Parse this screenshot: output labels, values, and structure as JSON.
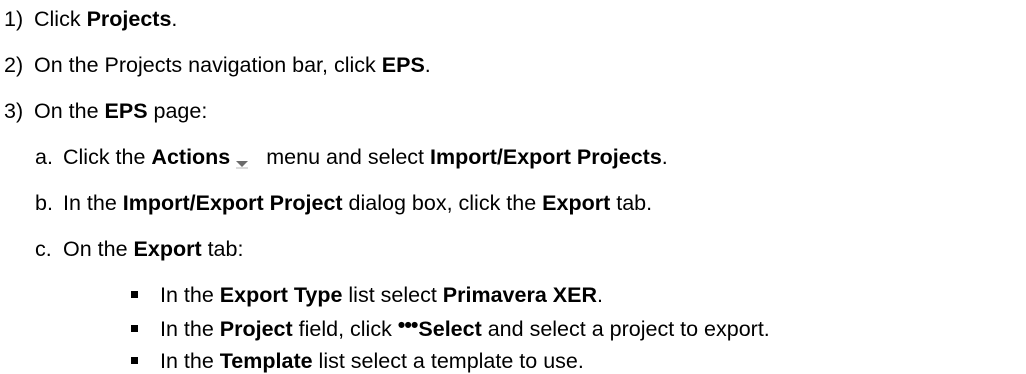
{
  "steps": [
    {
      "num": "1)",
      "t1": "Click ",
      "b1": "Projects",
      "t2": "."
    },
    {
      "num": "2)",
      "t1": "On the Projects navigation bar, click ",
      "b1": "EPS",
      "t2": "."
    },
    {
      "num": "3)",
      "t1": "On the ",
      "b1": "EPS",
      "t2": " page:"
    }
  ],
  "substeps": [
    {
      "letter": "a.",
      "t1": "Click the ",
      "b1": "Actions",
      "icon": "dropdown-arrow-icon",
      "t2": "menu and select ",
      "b2": "Import/Export Projects",
      "t3": "."
    },
    {
      "letter": "b.",
      "t1": "In the ",
      "b1": "Import/Export Project",
      "t2": " dialog box, click the ",
      "b2": "Export",
      "t3": " tab."
    },
    {
      "letter": "c.",
      "t1": "On the ",
      "b1": "Export",
      "t2": " tab:"
    }
  ],
  "bullets": [
    {
      "t1": "In the ",
      "b1": "Export Type",
      "t2": " list select ",
      "b2": "Primavera XER",
      "t3": "."
    },
    {
      "t1": "In the ",
      "b1": "Project",
      "t2": " field, click ",
      "ellipsis": "•••",
      "b2": "Select",
      "t3": " and select a project to export."
    },
    {
      "t1": "In the ",
      "b1": "Template",
      "t2": " list select a template to use."
    }
  ],
  "colors": {
    "icon_arrow": "#6b6b6b",
    "icon_shadow": "#b8b8b8"
  }
}
